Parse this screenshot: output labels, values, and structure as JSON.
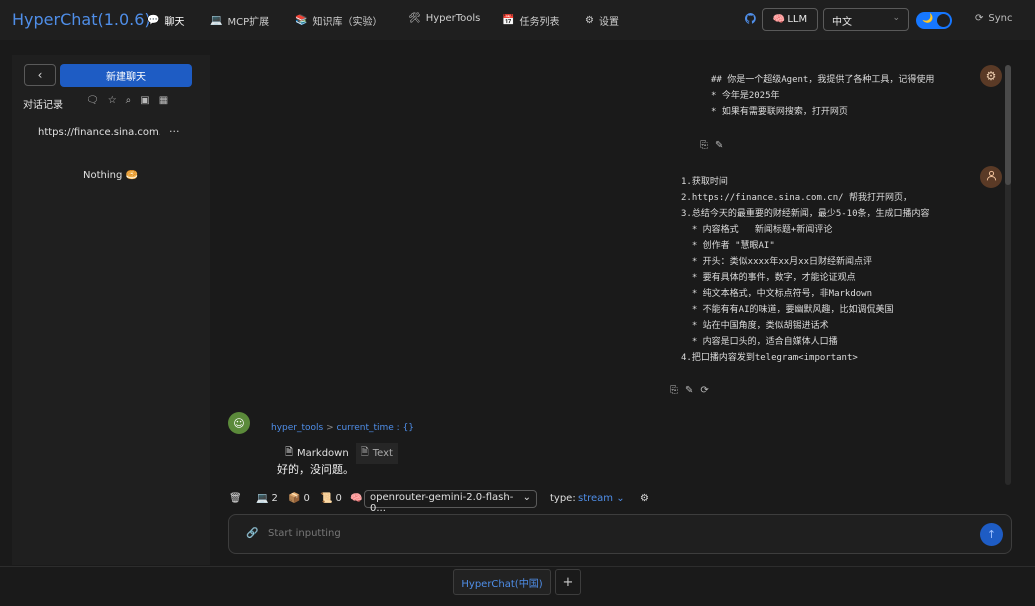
{
  "app": {
    "title": "HyperChat(1.0.6)"
  },
  "nav": [
    {
      "label": "聊天",
      "icon": "💬"
    },
    {
      "label": "MCP扩展",
      "icon": "💻"
    },
    {
      "label": "知识库（实验）",
      "icon": "📚"
    },
    {
      "label": "HyperTools",
      "icon": "🛠"
    },
    {
      "label": "任务列表",
      "icon": "📅"
    },
    {
      "label": "设置",
      "icon": "⚙"
    }
  ],
  "header": {
    "llm_label": "LLM",
    "llm_icon": "🧠",
    "language": "中文",
    "sync_label": "Sync",
    "theme_icon": "🌙"
  },
  "sidebar": {
    "new_chat": "新建聊天",
    "history_label": "对话记录",
    "history_item": "https://finance.sina.com.c...",
    "more": "···",
    "empty": "Nothing 🥯"
  },
  "messages": {
    "system": "## 你是一个超级Agent，我提供了各种工具，记得使用\n* 今年是2025年\n* 如果有需要联网搜索，打开网页",
    "user": "1.获取时间\n2.https://finance.sina.com.cn/ 帮我打开网页，\n3.总结今天的最重要的财经新闻，最少5-10条，生成口播内容\n  * 内容格式   新闻标题+新闻评论\n  * 创作者 \"慧眼AI\"\n  * 开头：类似xxxx年xx月xx日财经新闻点评\n  * 要有具体的事件，数字，才能论证观点\n  * 纯文本格式，中文标点符号，非Markdown\n  * 不能有有AI的味道，要幽默风趣，比如调侃美国\n  * 站在中国角度，类似胡锡进话术\n  * 内容是口头的，适合自媒体人口播\n4.把口播内容发到telegram<important>",
    "tool_name": "hyper_tools",
    "tool_arrow": ">",
    "tool_fn": "current_time : {}",
    "tab_markdown": "Markdown",
    "tab_text": "Text",
    "bot_reply": "好的，没问题。"
  },
  "toolbar": {
    "tools_count": "2",
    "resources_count": "0",
    "prompts_count": "0",
    "model": "openrouter-gemini-2.0-flash-0...",
    "type_label": "type:",
    "type_value": "stream"
  },
  "composer": {
    "placeholder": "Start inputting"
  },
  "tabs": {
    "active": "HyperChat(中国)",
    "add": "+"
  }
}
